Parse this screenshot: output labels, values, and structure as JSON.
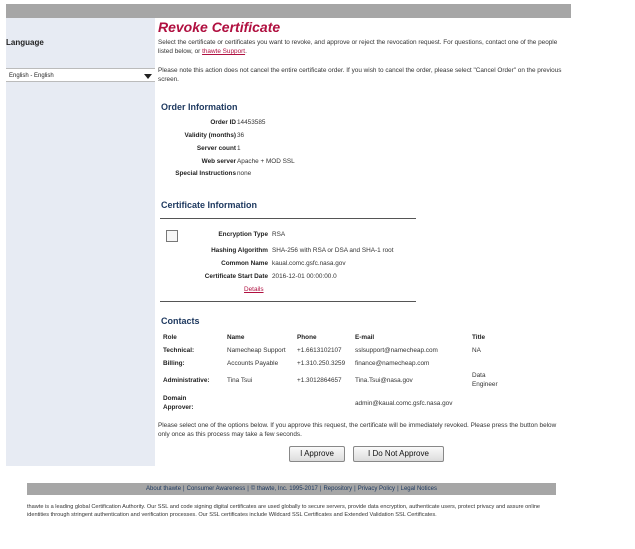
{
  "sidebar": {
    "language_label": "Language",
    "language_value": "English - English"
  },
  "main": {
    "title": "Revoke Certificate",
    "intro_text": "Select the certificate or certificates you want to revoke, and approve or reject the revocation request. For questions, contact one of the people listed below, or ",
    "intro_link": "thawte Support",
    "intro_end": ".",
    "note_text": "Please note this action does not cancel the entire certificate order. If you wish to cancel the order, please select \"Cancel Order\" on the previous screen.",
    "order": {
      "heading": "Order Information",
      "rows": [
        {
          "label": "Order ID",
          "value": "14453585"
        },
        {
          "label": "Validity (months)",
          "value": "36"
        },
        {
          "label": "Server count",
          "value": "1"
        },
        {
          "label": "Web server",
          "value": "Apache + MOD SSL"
        },
        {
          "label": "Special Instructions",
          "value": "none"
        }
      ]
    },
    "certificate": {
      "heading": "Certificate Information",
      "rows": [
        {
          "label": "Encryption Type",
          "value": "RSA"
        },
        {
          "label": "Hashing Algorithm",
          "value": "SHA-256 with RSA or DSA and SHA-1 root"
        },
        {
          "label": "Common Name",
          "value": "kaual.comc.gsfc.nasa.gov"
        },
        {
          "label": "Certificate Start Date",
          "value": "2016-12-01 00:00:00.0"
        }
      ],
      "details_link": "Details"
    },
    "contacts": {
      "heading": "Contacts",
      "columns": [
        "Role",
        "Name",
        "Phone",
        "E-mail",
        "Title"
      ],
      "rows": [
        {
          "role": "Technical:",
          "name": "Namecheap Support",
          "phone": "+1.6613102107",
          "email": "sslsupport@namecheap.com",
          "title": "NA"
        },
        {
          "role": "Billing:",
          "name": "Accounts Payable",
          "phone": "+1.310.250.3259",
          "email": "finance@namecheap.com",
          "title": ""
        },
        {
          "role": "Administrative:",
          "name": "Tina Tsui",
          "phone": "+1.3012864657",
          "email": "Tina.Tsui@nasa.gov",
          "title": "Data Engineer"
        },
        {
          "role": "Domain Approver:",
          "name": "",
          "phone": "",
          "email": "admin@kaual.comc.gsfc.nasa.gov",
          "title": ""
        }
      ]
    },
    "instructions": "Please select one of the options below. If you approve this request, the certificate will be immediately revoked. Please press the button below only once as this process may take a few seconds.",
    "approve_label": "I Approve",
    "reject_label": "I Do Not Approve"
  },
  "footer": {
    "links": [
      "About thawte",
      "Consumer Awareness",
      "© thawte, Inc. 1995-2017",
      "Repository",
      "Privacy Policy",
      "Legal Notices"
    ],
    "text": "thawte is a leading global Certification Authority. Our SSL and code signing digital certificates are used globally to secure servers, provide data encryption, authenticate users, protect privacy and assure online identities through stringent authentication and verification processes. Our SSL certificates include Wildcard SSL Certificates and Extended Validation SSL Certificates."
  }
}
